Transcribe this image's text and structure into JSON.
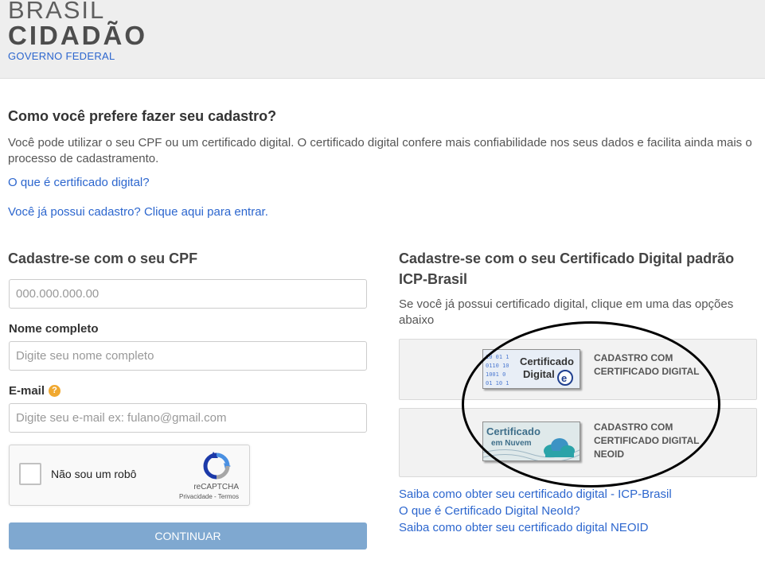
{
  "header": {
    "logo_line1": "BRASIL",
    "logo_line2": "CIDADÃO",
    "logo_line3": "GOVERNO FEDERAL"
  },
  "intro": {
    "heading": "Como você prefere fazer seu cadastro?",
    "text": "Você pode utilizar o seu CPF ou um certificado digital. O certificado digital confere mais confiabilidade nos seus dados e facilita ainda mais o processo de cadastramento.",
    "link_certificate": "O que é certificado digital?",
    "link_login": "Você já possui cadastro? Clique aqui para entrar."
  },
  "cpf_form": {
    "title": "Cadastre-se com o seu CPF",
    "cpf_placeholder": "000.000.000.00",
    "name_label": "Nome completo",
    "name_placeholder": "Digite seu nome completo",
    "email_label": "E-mail",
    "email_help_icon": "question-icon",
    "email_placeholder": "Digite seu e-mail ex: fulano@gmail.com",
    "captcha": {
      "label": "Não sou um robô",
      "brand": "reCAPTCHA",
      "privacy": "Privacidade - Termos"
    },
    "submit_label": "CONTINUAR"
  },
  "certificate": {
    "title": "Cadastre-se com o seu Certificado Digital padrão ICP-Brasil",
    "description": "Se você já possui certificado digital, clique em uma das opções abaixo",
    "options": [
      {
        "image_text_1": "Certificado",
        "image_text_2": "Digital",
        "label": "CADASTRO COM CERTIFICADO DIGITAL"
      },
      {
        "image_text_1": "Certificado",
        "image_text_2": "em Nuvem",
        "label": "CADASTRO COM CERTIFICADO DIGITAL NEOID"
      }
    ],
    "links": [
      "Saiba como obter seu certificado digital - ICP-Brasil",
      "O que é Certificado Digital NeoId?",
      "Saiba como obter seu certificado digital NEOID"
    ]
  },
  "colors": {
    "link": "#2c66ce",
    "button": "#7fa8d0",
    "header_bg": "#eeeeee",
    "annotation": "#000000"
  }
}
